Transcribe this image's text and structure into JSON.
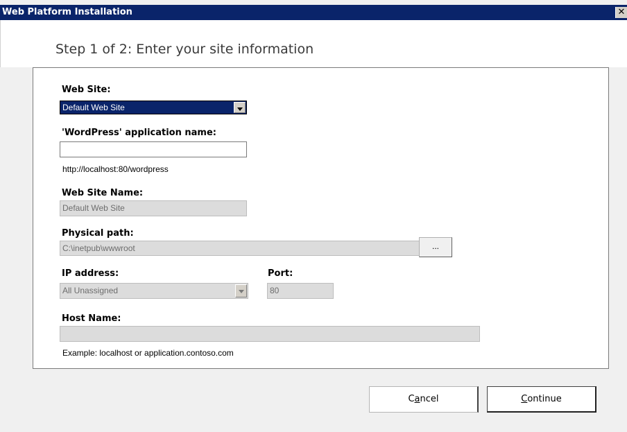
{
  "window": {
    "title": "Web Platform Installation",
    "close_glyph": "✕"
  },
  "header": {
    "step": "Step 1 of 2: Enter your site information"
  },
  "form": {
    "web_site": {
      "label": "Web Site:",
      "value": "Default Web Site"
    },
    "app_name": {
      "label": "'WordPress' application name:",
      "value": "",
      "url_hint": "http://localhost:80/wordpress"
    },
    "site_name": {
      "label": "Web Site Name:",
      "value": "Default Web Site"
    },
    "physical_path": {
      "label": "Physical path:",
      "value": "C:\\inetpub\\wwwroot",
      "browse_label": "..."
    },
    "ip_address": {
      "label": "IP address:",
      "value": "All Unassigned"
    },
    "port": {
      "label": "Port:",
      "value": "80"
    },
    "host_name": {
      "label": "Host Name:",
      "value": "",
      "example": "Example: localhost or application.contoso.com"
    }
  },
  "buttons": {
    "cancel": {
      "pre": "C",
      "accel": "a",
      "post": "ncel"
    },
    "continue": {
      "pre": "",
      "accel": "C",
      "post": "ontinue"
    }
  }
}
